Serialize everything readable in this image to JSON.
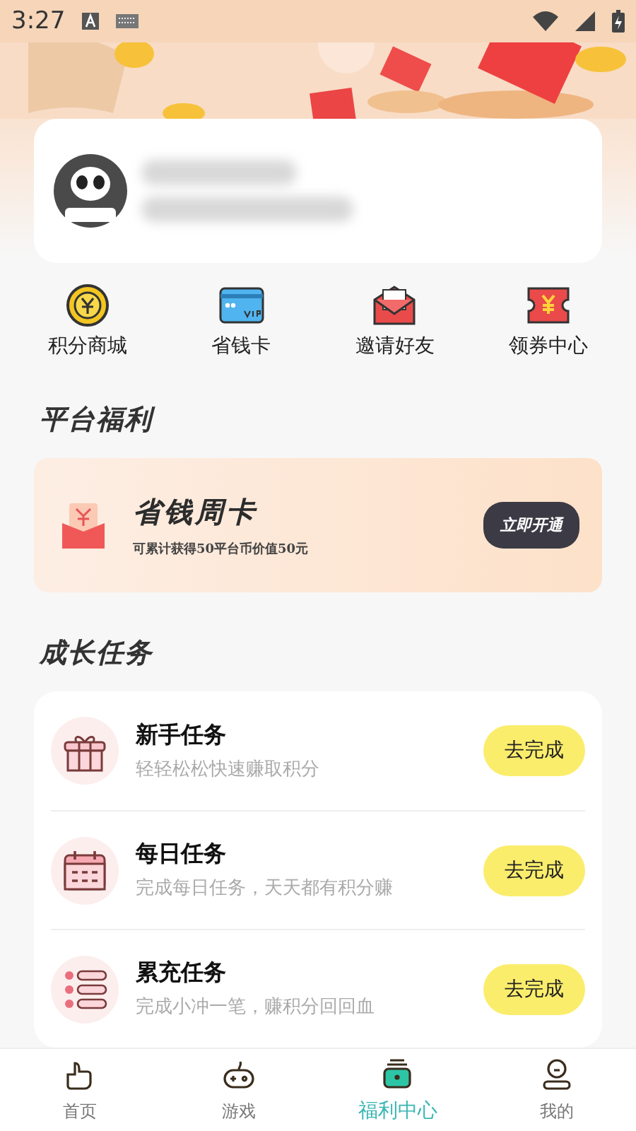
{
  "status_bar": {
    "time": "3:27"
  },
  "shortcuts": [
    {
      "kind": "coin",
      "label": "积分商城"
    },
    {
      "kind": "vip",
      "label": "省钱卡"
    },
    {
      "kind": "envelope",
      "label": "邀请好友"
    },
    {
      "kind": "coupon",
      "label": "领券中心"
    }
  ],
  "platform_benefits": {
    "title": "平台福利",
    "card": {
      "title": "省钱周卡",
      "subtitle": "可累计获得50平台币价值50元",
      "button": "立即开通"
    }
  },
  "growth_tasks": {
    "title": "成长任务",
    "tasks": [
      {
        "kind": "gift",
        "title": "新手任务",
        "description": "轻轻松松快速赚取积分",
        "button": "去完成"
      },
      {
        "kind": "calendar",
        "title": "每日任务",
        "description": "完成每日任务，天天都有积分赚",
        "button": "去完成"
      },
      {
        "kind": "list",
        "title": "累充任务",
        "description": "完成小冲一笔，赚积分回回血",
        "button": "去完成"
      }
    ]
  },
  "bottom_nav": [
    {
      "kind": "home",
      "label": "首页",
      "selected": false
    },
    {
      "kind": "game",
      "label": "游戏",
      "selected": false
    },
    {
      "kind": "welfare",
      "label": "福利中心",
      "selected": true
    },
    {
      "kind": "user",
      "label": "我的",
      "selected": false
    }
  ]
}
